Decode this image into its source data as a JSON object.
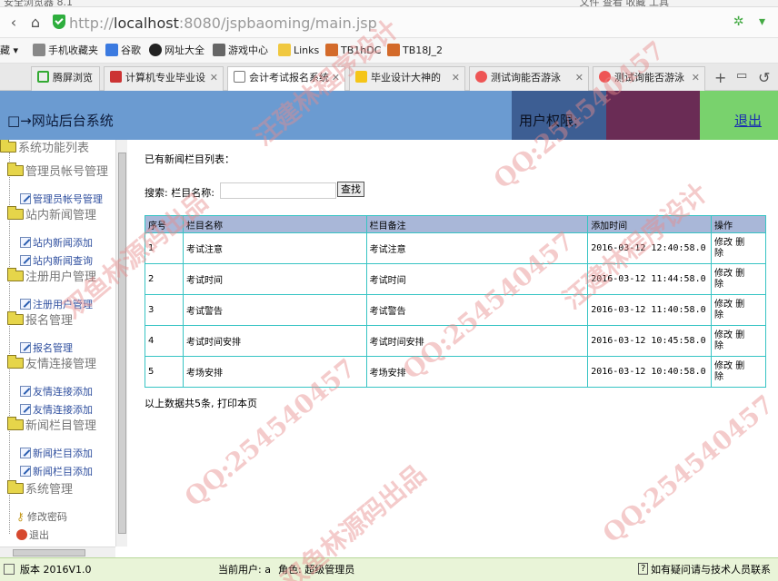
{
  "browser": {
    "title_partial": "安全浏览器 8.1",
    "menu_partial": "文件   查看   收藏   工具",
    "url_prefix": "http://",
    "url_host": "localhost",
    "url_path": ":8080/jspbaoming/main.jsp",
    "bookmarks": [
      "藏 ▾",
      "手机收藏夹",
      "谷歌",
      "网址大全",
      "游戏中心",
      "Links",
      "TB1hDC",
      "TB18J_2"
    ],
    "tabs": [
      {
        "label": "腾屏浏览",
        "active": false
      },
      {
        "label": "计算机专业毕业设",
        "active": false
      },
      {
        "label": "会计考试报名系统",
        "active": true
      },
      {
        "label": "毕业设计大神的",
        "active": false
      },
      {
        "label": "测试询能否游泳",
        "active": false
      },
      {
        "label": "测试询能否游泳",
        "active": false
      }
    ]
  },
  "header": {
    "system_title": "□→网站后台系统",
    "perm_label": "用户权限:",
    "logout": "退出"
  },
  "sidebar": {
    "root": "系统功能列表",
    "groups": [
      {
        "label": "管理员帐号管理",
        "items": [
          "管理员帐号管理"
        ]
      },
      {
        "label": "站内新闻管理",
        "items": [
          "站内新闻添加",
          "站内新闻查询"
        ]
      },
      {
        "label": "注册用户管理",
        "items": [
          "注册用户管理"
        ]
      },
      {
        "label": "报名管理",
        "items": [
          "报名管理"
        ]
      },
      {
        "label": "友情连接管理",
        "items": [
          "友情连接添加",
          "友情连接添加"
        ]
      },
      {
        "label": "新闻栏目管理",
        "items": [
          "新闻栏目添加",
          "新闻栏目添加"
        ]
      },
      {
        "label": "系统管理",
        "items": []
      }
    ],
    "extra": [
      "修改密码",
      "退出"
    ]
  },
  "main": {
    "heading": "已有新闻栏目列表：",
    "search_label": "搜索: 栏目名称:",
    "search_value": "",
    "search_button": "查找",
    "columns": [
      "序号",
      "栏目名称",
      "栏目备注",
      "添加时间",
      "操作"
    ],
    "rows": [
      {
        "no": "1",
        "name": "考试注意",
        "note": "考试注意",
        "time": "2016-03-12 12:40:58.0",
        "edit": "修改",
        "del": "删",
        "del2": "除"
      },
      {
        "no": "2",
        "name": "考试时间",
        "note": "考试时间",
        "time": "2016-03-12 11:44:58.0",
        "edit": "修改",
        "del": "删",
        "del2": "除"
      },
      {
        "no": "3",
        "name": "考试警告",
        "note": "考试警告",
        "time": "2016-03-12 11:40:58.0",
        "edit": "修改",
        "del": "删",
        "del2": "除"
      },
      {
        "no": "4",
        "name": "考试时间安排",
        "note": "考试时间安排",
        "time": "2016-03-12 10:45:58.0",
        "edit": "修改",
        "del": "删",
        "del2": "除"
      },
      {
        "no": "5",
        "name": "考场安排",
        "note": "考场安排",
        "time": "2016-03-12 10:40:58.0",
        "edit": "修改",
        "del": "删",
        "del2": "除"
      }
    ],
    "summary": "以上数据共5条,",
    "print": "打印本页"
  },
  "status": {
    "version": "版本 2016V1.0",
    "current_user": "当前用户: a",
    "role": "角色: 超级管理员",
    "help": "如有疑问请与技术人员联系"
  },
  "watermarks": [
    "汪建林程序设计",
    "QQ:254540457",
    "双鱼林源码出品",
    "QQ:254540457",
    "汪建林程序设计",
    "QQ:254540457",
    "双鱼林源码出品",
    "QQ:254540457"
  ]
}
